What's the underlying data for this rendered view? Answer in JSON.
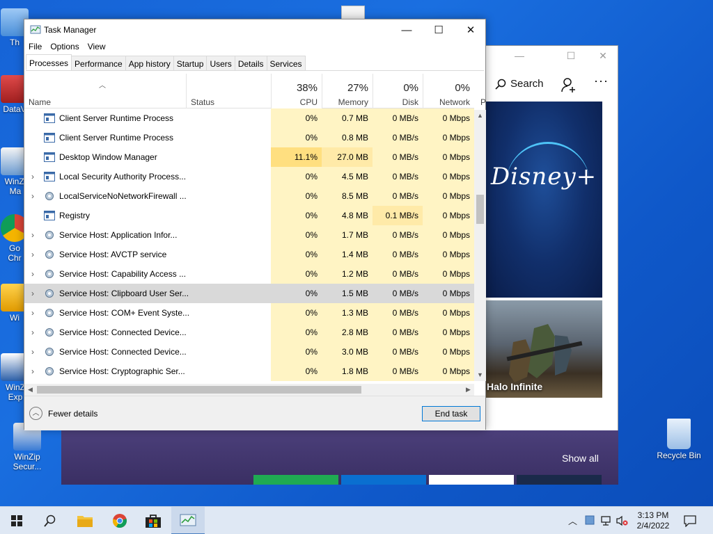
{
  "desktop": {
    "icons": [
      {
        "label": "Th"
      },
      {
        "label": "DataV"
      },
      {
        "label": "WinZi Ma"
      },
      {
        "label": "Go Chr"
      },
      {
        "label": "Wi"
      },
      {
        "label": "WinZ Exp"
      },
      {
        "label": "WinZip Secur..."
      },
      {
        "label": "Recycle Bin"
      }
    ]
  },
  "store": {
    "search_label": "Search",
    "more_label": "···",
    "disney_label": "Disney+",
    "halo_label": "Halo Infinite",
    "show_all": "Show all"
  },
  "task_manager": {
    "title": "Task Manager",
    "menu": [
      "File",
      "Options",
      "View"
    ],
    "tabs": [
      "Processes",
      "Performance",
      "App history",
      "Startup",
      "Users",
      "Details",
      "Services"
    ],
    "columns": {
      "name": "Name",
      "status": "Status",
      "cpu": {
        "pct": "38%",
        "label": "CPU"
      },
      "memory": {
        "pct": "27%",
        "label": "Memory"
      },
      "disk": {
        "pct": "0%",
        "label": "Disk"
      },
      "network": {
        "pct": "0%",
        "label": "Network"
      },
      "extra": "P"
    },
    "rows": [
      {
        "name": "Client Server Runtime Process",
        "cpu": "0%",
        "mem": "0.7 MB",
        "disk": "0 MB/s",
        "net": "0 Mbps"
      },
      {
        "name": "Client Server Runtime Process",
        "cpu": "0%",
        "mem": "0.8 MB",
        "disk": "0 MB/s",
        "net": "0 Mbps"
      },
      {
        "name": "Desktop Window Manager",
        "cpu": "11.1%",
        "mem": "27.0 MB",
        "disk": "0 MB/s",
        "net": "0 Mbps"
      },
      {
        "name": "Local Security Authority Process...",
        "cpu": "0%",
        "mem": "4.5 MB",
        "disk": "0 MB/s",
        "net": "0 Mbps"
      },
      {
        "name": "LocalServiceNoNetworkFirewall ...",
        "cpu": "0%",
        "mem": "8.5 MB",
        "disk": "0 MB/s",
        "net": "0 Mbps"
      },
      {
        "name": "Registry",
        "cpu": "0%",
        "mem": "4.8 MB",
        "disk": "0.1 MB/s",
        "net": "0 Mbps"
      },
      {
        "name": "Service Host: Application Infor...",
        "cpu": "0%",
        "mem": "1.7 MB",
        "disk": "0 MB/s",
        "net": "0 Mbps"
      },
      {
        "name": "Service Host: AVCTP service",
        "cpu": "0%",
        "mem": "1.4 MB",
        "disk": "0 MB/s",
        "net": "0 Mbps"
      },
      {
        "name": "Service Host: Capability Access ...",
        "cpu": "0%",
        "mem": "1.2 MB",
        "disk": "0 MB/s",
        "net": "0 Mbps"
      },
      {
        "name": "Service Host: Clipboard User Ser...",
        "cpu": "0%",
        "mem": "1.5 MB",
        "disk": "0 MB/s",
        "net": "0 Mbps"
      },
      {
        "name": "Service Host: COM+ Event Syste...",
        "cpu": "0%",
        "mem": "1.3 MB",
        "disk": "0 MB/s",
        "net": "0 Mbps"
      },
      {
        "name": "Service Host: Connected Device...",
        "cpu": "0%",
        "mem": "2.8 MB",
        "disk": "0 MB/s",
        "net": "0 Mbps"
      },
      {
        "name": "Service Host: Connected Device...",
        "cpu": "0%",
        "mem": "3.0 MB",
        "disk": "0 MB/s",
        "net": "0 Mbps"
      },
      {
        "name": "Service Host: Cryptographic Ser...",
        "cpu": "0%",
        "mem": "1.8 MB",
        "disk": "0 MB/s",
        "net": "0 Mbps"
      }
    ],
    "fewer_details": "Fewer details",
    "end_task": "End task"
  },
  "taskbar": {
    "time": "3:13 PM",
    "date": "2/4/2022"
  },
  "colors": {
    "accent": "#0078d7",
    "heat_low": "#fff4c4",
    "heat_high": "#ffdf80",
    "selected_row": "#d9d9d9"
  }
}
